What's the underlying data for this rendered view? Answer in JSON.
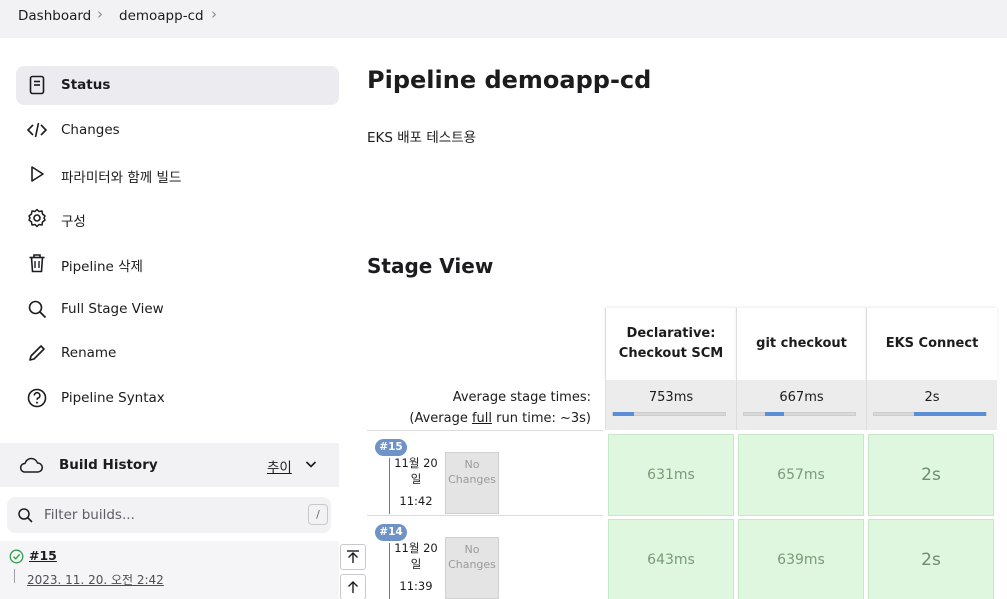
{
  "breadcrumb": {
    "items": [
      "Dashboard",
      "demoapp-cd"
    ]
  },
  "sidebar": {
    "items": [
      {
        "label": "Status",
        "icon": "document-icon"
      },
      {
        "label": "Changes",
        "icon": "code-icon"
      },
      {
        "label": "파라미터와 함께 빌드",
        "icon": "play-icon"
      },
      {
        "label": "구성",
        "icon": "gear-icon"
      },
      {
        "label": "Pipeline 삭제",
        "icon": "trash-icon"
      },
      {
        "label": "Full Stage View",
        "icon": "search-icon"
      },
      {
        "label": "Rename",
        "icon": "pencil-icon"
      },
      {
        "label": "Pipeline Syntax",
        "icon": "help-icon"
      }
    ]
  },
  "build_history": {
    "title": "Build History",
    "trend_label": "추이",
    "filter_placeholder": "Filter builds...",
    "filter_shortcut": "/",
    "builds": [
      {
        "number": "#15",
        "date": "2023. 11. 20. 오전 2:42",
        "status": "success"
      }
    ]
  },
  "main": {
    "title": "Pipeline demoapp-cd",
    "description": "EKS 배포 테스트용",
    "stage_view_title": "Stage View"
  },
  "stage_view": {
    "stages": [
      "Declarative: Checkout SCM",
      "git checkout",
      "EKS Connect"
    ],
    "avg_label": "Average stage times:",
    "avg_full_prefix": "(Average ",
    "avg_full_link": "full",
    "avg_full_suffix": " run time: ~3s)",
    "avg_times": [
      "753ms",
      "667ms",
      "2s"
    ],
    "avg_bar_fraction": [
      0.19,
      0.17,
      0.64
    ],
    "runs": [
      {
        "badge": "#15",
        "date": "11월 20 일",
        "time": "11:42",
        "changes": "No Changes",
        "durations": [
          "631ms",
          "657ms",
          "2s"
        ]
      },
      {
        "badge": "#14",
        "date": "11월 20 일",
        "time": "11:39",
        "changes": "No Changes",
        "durations": [
          "643ms",
          "639ms",
          "2s"
        ]
      }
    ]
  },
  "colors": {
    "success_cell": "#dff7df",
    "bar_fill": "#5a8ed6",
    "badge": "#6f93c6",
    "ok_green": "#2e9e4b"
  }
}
